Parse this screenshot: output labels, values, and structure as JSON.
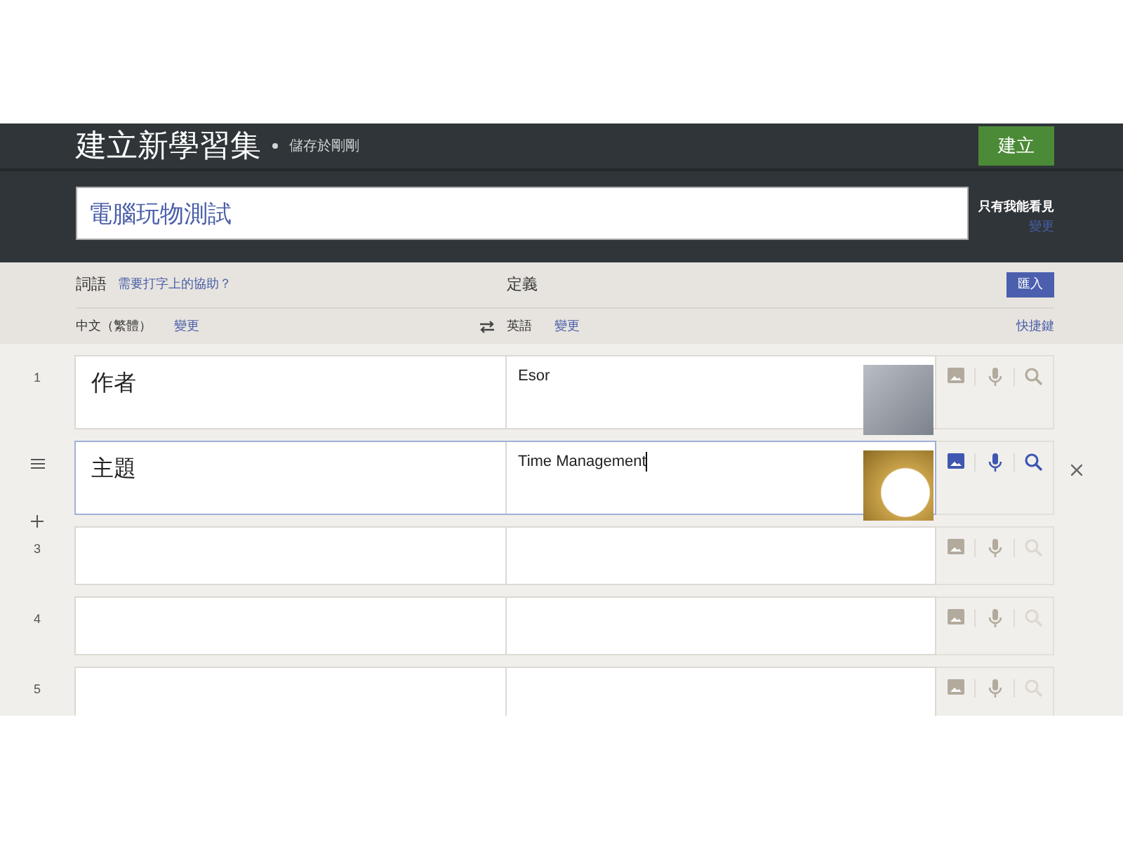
{
  "header": {
    "title": "建立新學習集",
    "save_status": "儲存於剛剛",
    "create_button": "建立"
  },
  "set_title": {
    "value": "電腦玩物測試"
  },
  "visibility": {
    "label": "只有我能看見",
    "change_link": "變更"
  },
  "columns": {
    "term_label": "詞語",
    "typing_help_link": "需要打字上的協助？",
    "definition_label": "定義",
    "import_button": "匯入",
    "term_language": "中文（繁體）",
    "term_change_link": "變更",
    "definition_language": "英語",
    "definition_change_link": "變更",
    "shortcuts_link": "快捷鍵"
  },
  "cards": [
    {
      "number": "1",
      "term": "作者",
      "definition": "Esor",
      "has_image": true,
      "selected": false
    },
    {
      "term": "主題",
      "definition": "Time Management",
      "has_image": true,
      "selected": true
    },
    {
      "number": "3",
      "has_image": false,
      "selected": false
    },
    {
      "number": "4",
      "has_image": false,
      "selected": false
    },
    {
      "number": "5",
      "has_image": false,
      "selected": false
    }
  ]
}
